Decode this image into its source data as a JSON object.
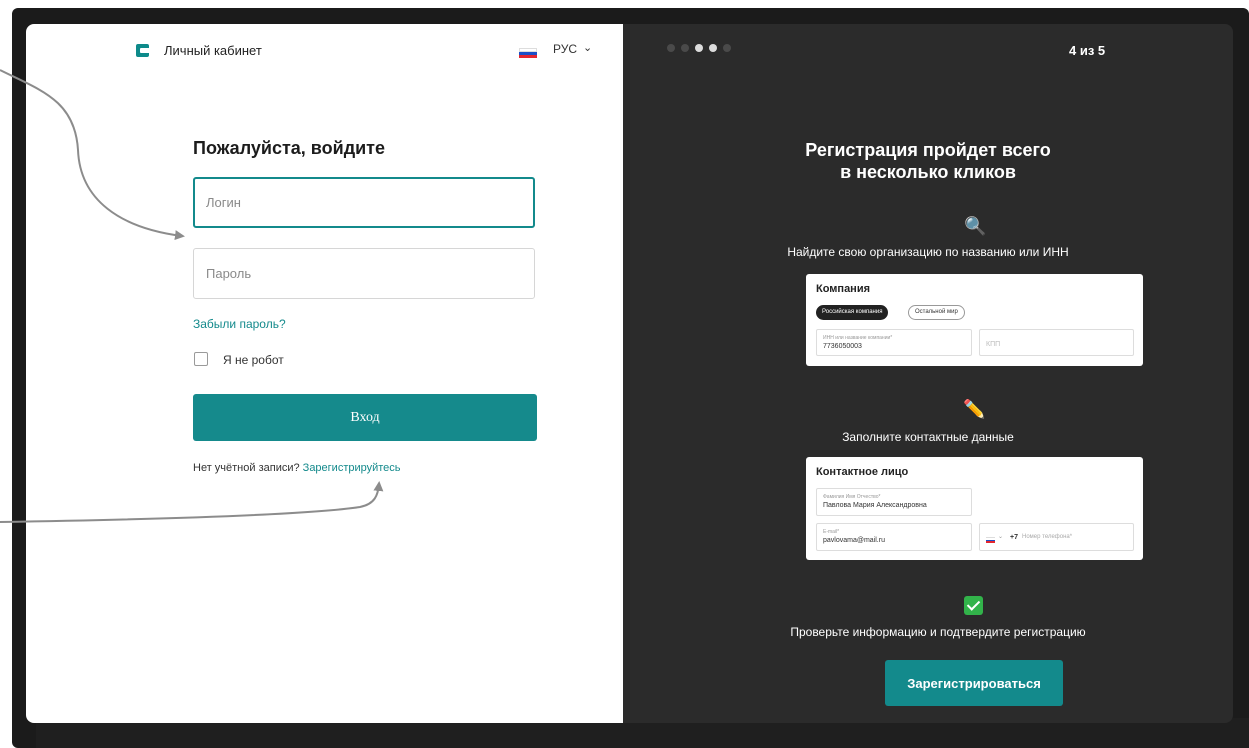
{
  "header": {
    "brand": "Личный кабинет",
    "lang": "РУС",
    "flag_colors": [
      "#ffffff",
      "#1b4fc8",
      "#e3262f"
    ]
  },
  "login": {
    "title": "Пожалуйста, войдите",
    "login_placeholder": "Логин",
    "password_placeholder": "Пароль",
    "forgot": "Забыли пароль?",
    "captcha_label": "Я не робот",
    "submit": "Вход",
    "no_account": "Нет учётной записи?",
    "register_link": "Зарегистрируйтесь"
  },
  "onboarding": {
    "step_total": 5,
    "step_current": 4,
    "step_text": "4 из 5",
    "title_line1": "Регистрация пройдет всего",
    "title_line2": "в несколько кликов",
    "step1_icon": "🔍",
    "step1_text": "Найдите свою организацию по названию или ИНН",
    "company_card": {
      "title": "Компания",
      "tab_active": "Российская компания",
      "tab_inactive": "Остальной мир",
      "inn_label": "ИНН или название компании*",
      "inn_value": "7736050003",
      "kpp_placeholder": "КПП"
    },
    "step2_icon": "✏️",
    "step2_text": "Заполните контактные данные",
    "contact_card": {
      "title": "Контактное лицо",
      "fio_label": "Фамилия Имя Отчество*",
      "fio_value": "Павлова Мария Александровна",
      "email_label": "E-mail*",
      "email_value": "pavlovama@mail.ru",
      "phone_code": "+7",
      "phone_placeholder": "Номер телефона*"
    },
    "step3_icon": "check-mark-icon",
    "step3_text": "Проверьте информацию и подтвердите регистрацию",
    "register_button": "Зарегистрироваться"
  },
  "colors": {
    "accent": "#138a8c",
    "dark_panel": "#2b2b2b",
    "monitor": "#1b1b1b"
  }
}
